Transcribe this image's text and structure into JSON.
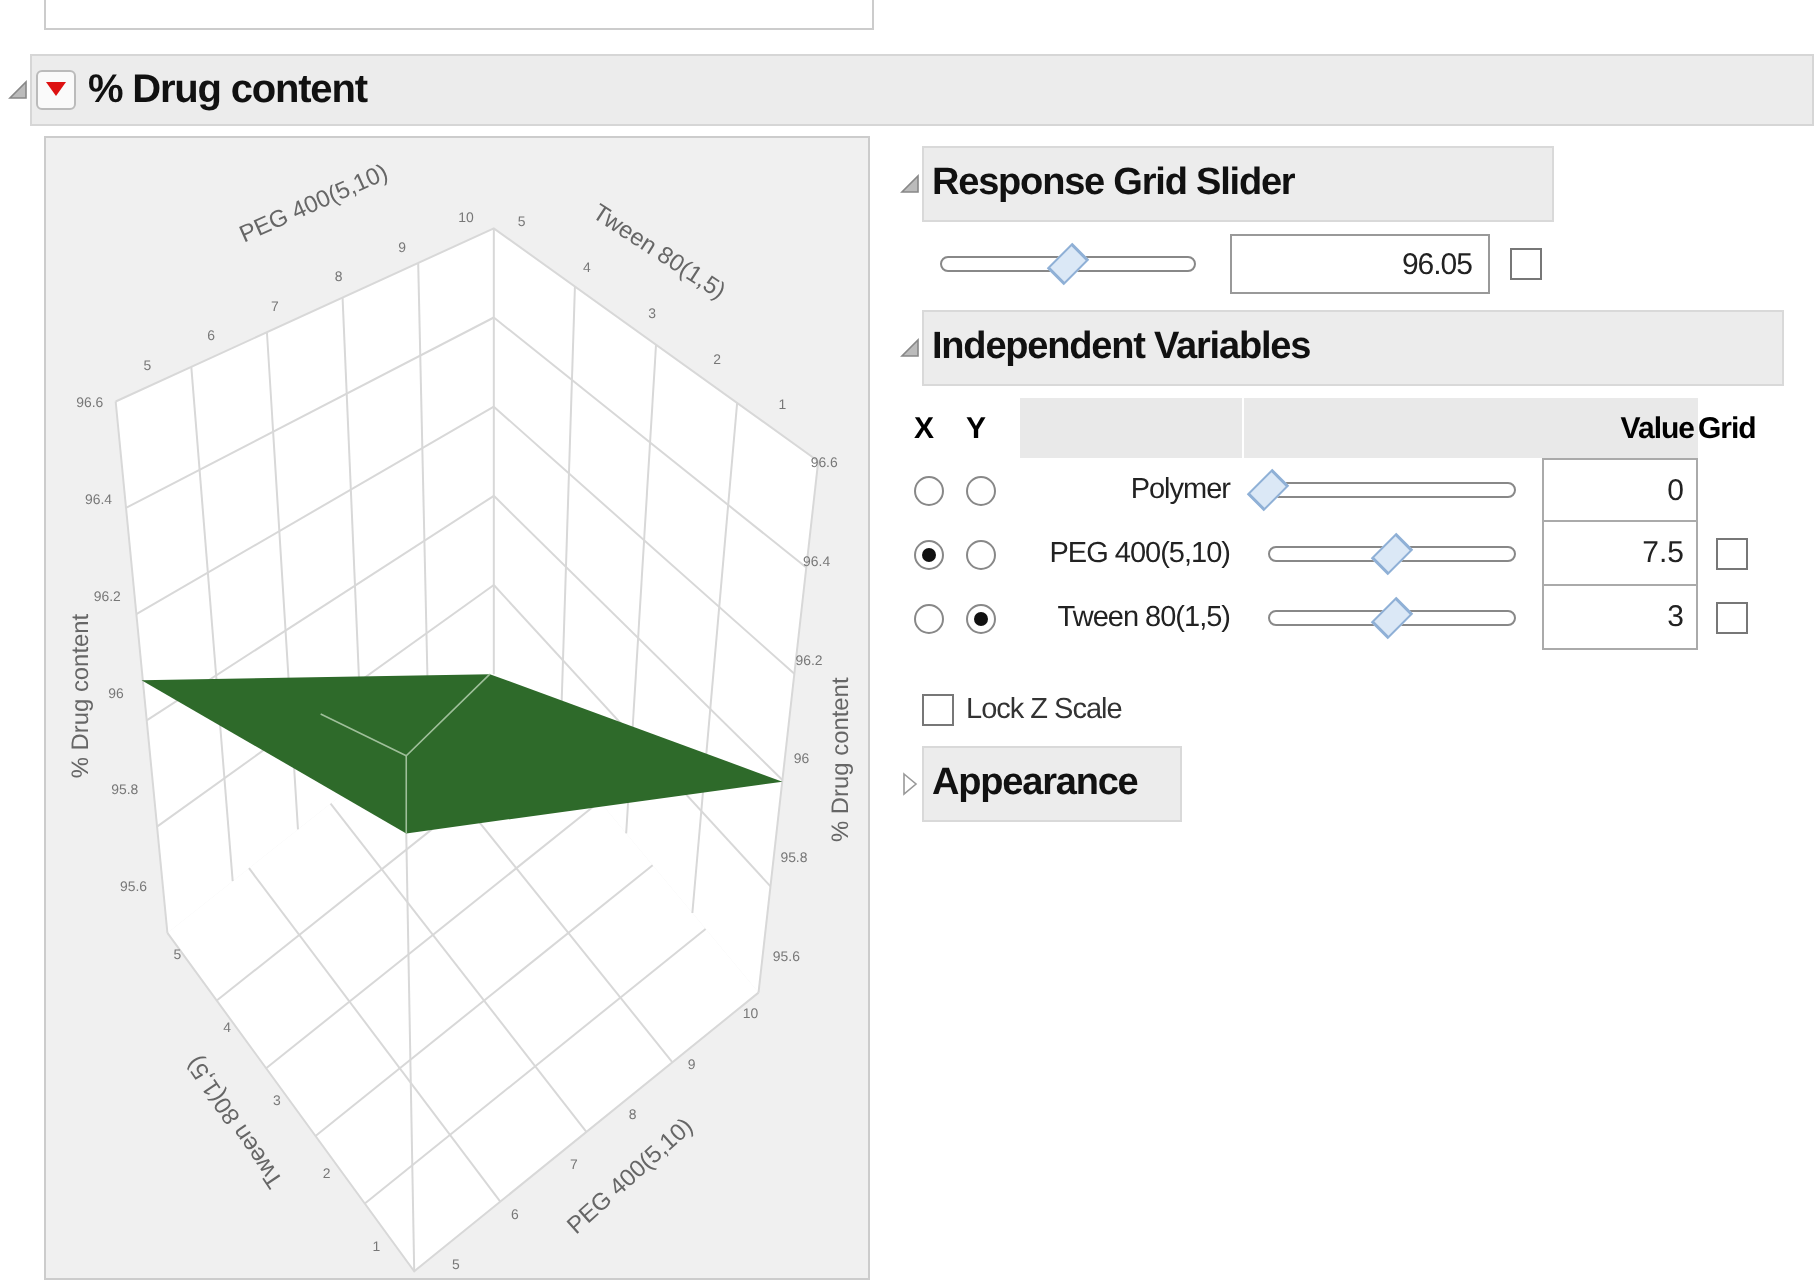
{
  "section": {
    "title": "% Drug content",
    "expanded": true
  },
  "plot": {
    "top_left_axis": {
      "title": "PEG 400(5,10)",
      "ticks": [
        "5",
        "6",
        "7",
        "8",
        "9",
        "10"
      ]
    },
    "top_right_axis": {
      "title": "Tween 80(1,5)",
      "ticks": [
        "5",
        "4",
        "3",
        "2",
        "1"
      ]
    },
    "left_z_axis": {
      "title": "% Drug content",
      "ticks": [
        "96.6",
        "96.4",
        "96.2",
        "96",
        "95.8",
        "95.6"
      ]
    },
    "right_z_axis": {
      "title": "% Drug content",
      "ticks": [
        "96.6",
        "96.4",
        "96.2",
        "96",
        "95.8",
        "95.6"
      ]
    },
    "bottom_left_axis": {
      "title": "Tween 80(1,5)",
      "ticks": [
        "5",
        "4",
        "3",
        "2",
        "1"
      ]
    },
    "bottom_right_axis": {
      "title": "PEG 400(5,10)",
      "ticks": [
        "5",
        "6",
        "7",
        "8",
        "9",
        "10"
      ]
    }
  },
  "response_grid_slider": {
    "title": "Response Grid Slider",
    "expanded": true,
    "level": 0.5,
    "value": "96.05",
    "grid_checked": false
  },
  "independent_variables": {
    "title": "Independent Variables",
    "expanded": true,
    "columns": [
      "X",
      "Y",
      "Value",
      "Grid"
    ],
    "rows": [
      {
        "name": "Polymer",
        "x_selected": false,
        "y_selected": false,
        "level": 0,
        "value": "0"
      },
      {
        "name": "PEG 400(5,10)",
        "x_selected": true,
        "y_selected": false,
        "level": 0.5,
        "value": "7.5",
        "grid": {
          "checked": false
        }
      },
      {
        "name": "Tween 80(1,5)",
        "x_selected": false,
        "y_selected": true,
        "level": 0.5,
        "value": "3",
        "grid": {
          "checked": false
        }
      }
    ]
  },
  "lock_z_scale": {
    "label": "Lock Z Scale",
    "checked": false
  },
  "appearance": {
    "title": "Appearance",
    "expanded": false
  }
}
